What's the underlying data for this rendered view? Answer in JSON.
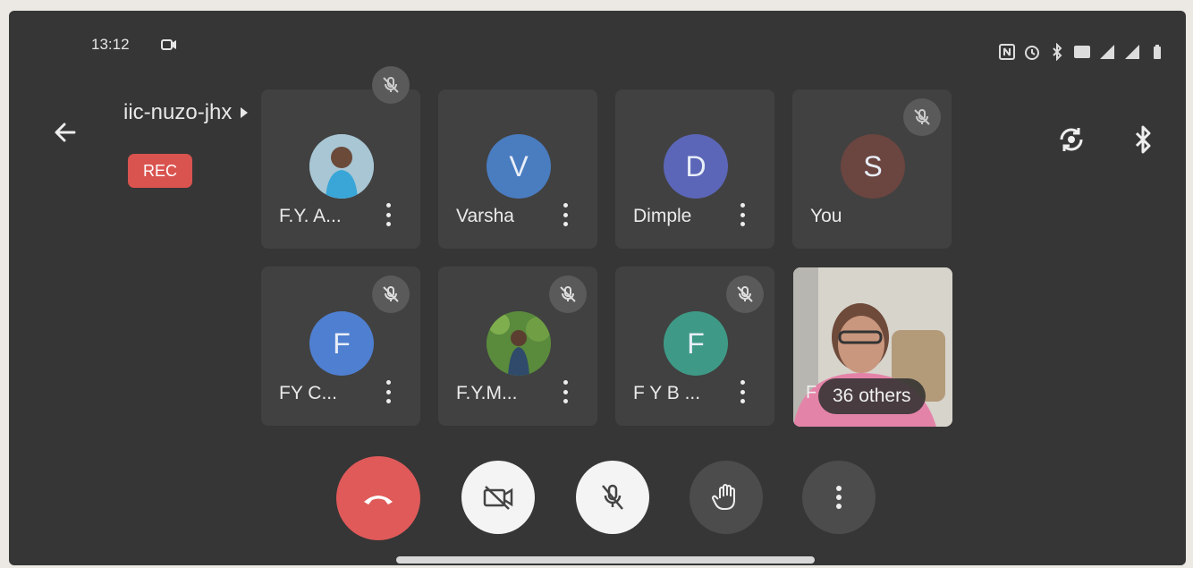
{
  "status_bar": {
    "time": "13:12",
    "left_icon": "camera-outline-icon",
    "right_icons": [
      "nfc-icon",
      "alarm-icon",
      "bluetooth-vibrate-icon",
      "volte-icon",
      "4g-signal-icon",
      "signal-icon",
      "battery-icon"
    ]
  },
  "header": {
    "meeting_code": "iic-nuzo-jhx",
    "rec_label": "REC",
    "back_icon": "back-arrow-icon",
    "switch_camera_icon": "switch-camera-icon",
    "audio_output_icon": "bluetooth-icon"
  },
  "participants": [
    {
      "name": "F.Y. A...",
      "avatar_letter": "",
      "avatar_type": "photo-woman-blue",
      "muted": true
    },
    {
      "name": "Varsha",
      "avatar_letter": "V",
      "avatar_color": "#4a7cc0",
      "muted": false
    },
    {
      "name": "Dimple",
      "avatar_letter": "D",
      "avatar_color": "#5c66b8",
      "muted": false
    },
    {
      "name": "You",
      "avatar_letter": "S",
      "avatar_color": "#6b4540",
      "muted": true
    },
    {
      "name": "FY C...",
      "avatar_letter": "F",
      "avatar_color": "#4f7fd0",
      "muted": true
    },
    {
      "name": "F.Y.M...",
      "avatar_letter": "",
      "avatar_type": "photo-man-leaves",
      "muted": true
    },
    {
      "name": "F Y B ...",
      "avatar_letter": "F",
      "avatar_color": "#3e9a86",
      "muted": true
    }
  ],
  "video_tile": {
    "others_label": "36 others",
    "name_peek": "F"
  },
  "controls": {
    "end_call_icon": "end-call-icon",
    "camera_icon": "camera-off-icon",
    "mic_icon": "mic-off-icon",
    "hand_icon": "raise-hand-icon",
    "more_icon": "more-vert-icon"
  },
  "colors": {
    "background": "#363636",
    "tile": "#414141",
    "rec": "#d9534f",
    "end_call": "#e05a5a"
  }
}
